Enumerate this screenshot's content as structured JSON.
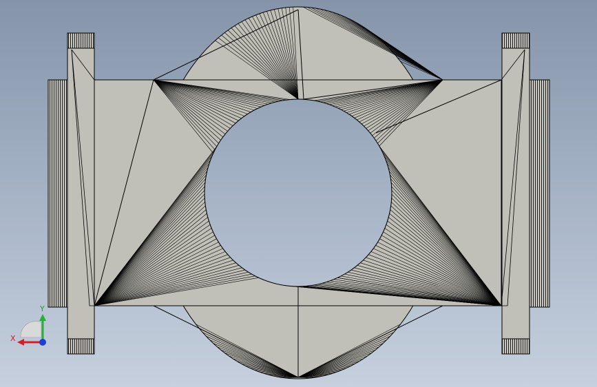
{
  "viewport": {
    "background_top": "#8594a9",
    "background_bottom": "#c6d0de",
    "part_fill": "#c0c0b8",
    "edge_color": "#000000"
  },
  "triad": {
    "x_label": "X",
    "y_label": "Y",
    "x_color": "#d21f2a",
    "y_color": "#25b03a",
    "z_color": "#1f3fd0"
  }
}
